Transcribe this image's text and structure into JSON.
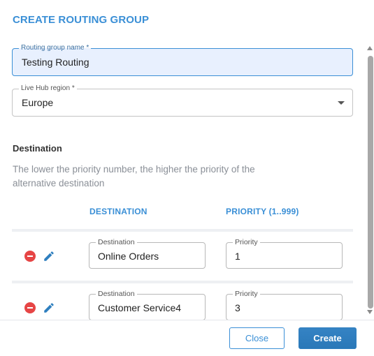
{
  "dialog": {
    "title": "CREATE ROUTING GROUP"
  },
  "form": {
    "routing_group_name": {
      "label": "Routing group name *",
      "value": "Testing Routing"
    },
    "live_hub_region": {
      "label": "Live Hub region *",
      "value": "Europe"
    }
  },
  "destination_section": {
    "title": "Destination",
    "helper": "The lower the priority number, the higher the priority of the alternative destination",
    "columns": [
      "DESTINATION",
      "PRIORITY (1..999)"
    ],
    "rows": [
      {
        "destination_label": "Destination",
        "destination": "Online Orders",
        "priority_label": "Priority",
        "priority": "1"
      },
      {
        "destination_label": "Destination",
        "destination": "Customer Service4",
        "priority_label": "Priority",
        "priority": "3"
      }
    ]
  },
  "footer": {
    "close_label": "Close",
    "create_label": "Create"
  },
  "colors": {
    "accent": "#3a8fd6",
    "remove": "#e64545",
    "focused_field_bg": "#e8f0fe"
  },
  "icons": [
    "remove-icon",
    "edit-icon",
    "chevron-down-icon"
  ]
}
